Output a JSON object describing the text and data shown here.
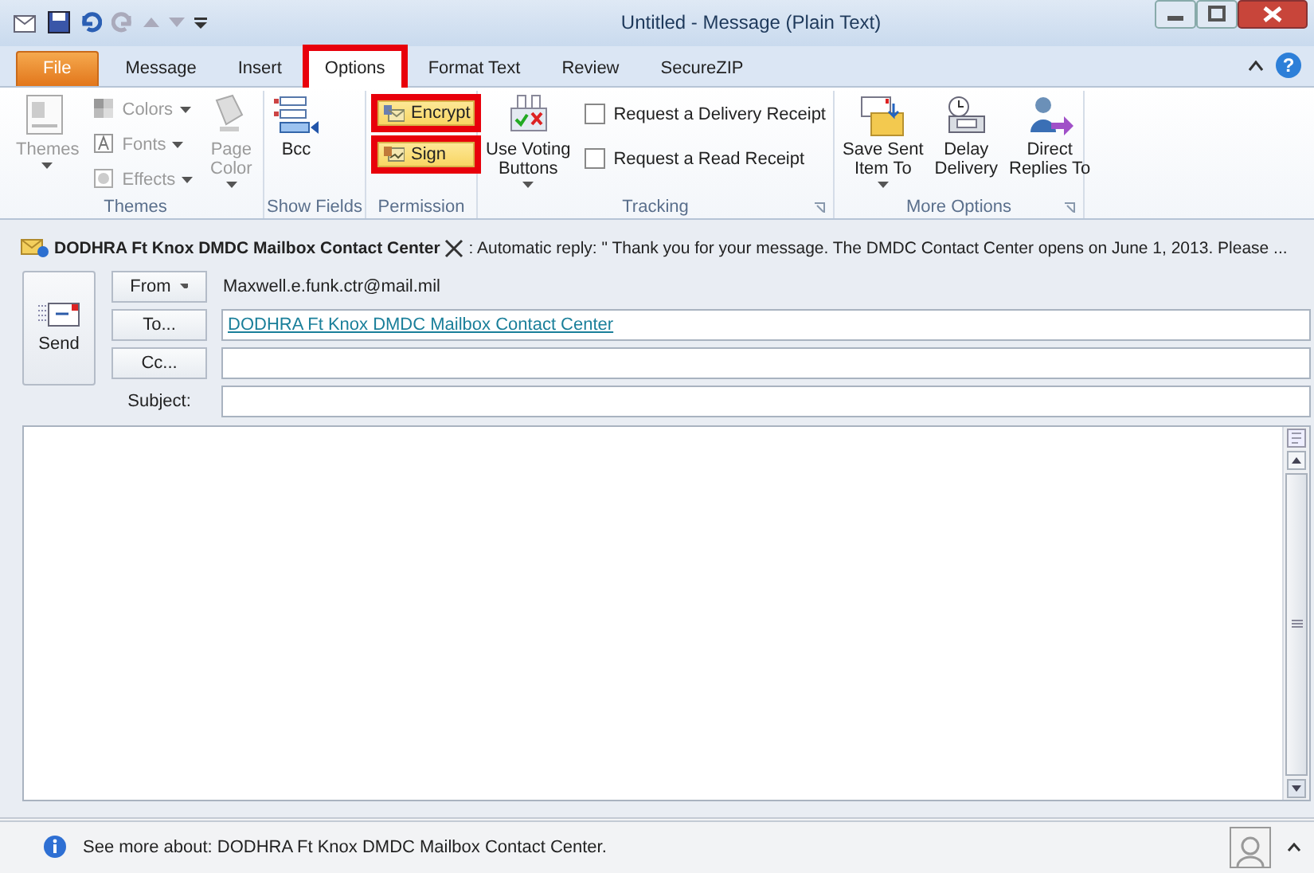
{
  "window": {
    "title": "Untitled - Message (Plain Text)"
  },
  "tabs": [
    {
      "label": "File",
      "kind": "file",
      "selected": false,
      "highlighted": false
    },
    {
      "label": "Message",
      "kind": "tab",
      "selected": false,
      "highlighted": false
    },
    {
      "label": "Insert",
      "kind": "tab",
      "selected": false,
      "highlighted": false
    },
    {
      "label": "Options",
      "kind": "tab",
      "selected": true,
      "highlighted": true
    },
    {
      "label": "Format Text",
      "kind": "tab",
      "selected": false,
      "highlighted": false
    },
    {
      "label": "Review",
      "kind": "tab",
      "selected": false,
      "highlighted": false
    },
    {
      "label": "SecureZIP",
      "kind": "tab",
      "selected": false,
      "highlighted": false
    }
  ],
  "help_label": "?",
  "ribbon_groups": [
    {
      "label": "Themes",
      "items": [
        {
          "kind": "large",
          "label": "Themes",
          "disabled": true,
          "dropdown": true,
          "on": false,
          "highlighted": false
        },
        {
          "kind": "small",
          "label": "Colors",
          "disabled": true,
          "dropdown": true,
          "on": false,
          "highlighted": false
        },
        {
          "kind": "small",
          "label": "Fonts",
          "disabled": true,
          "dropdown": true,
          "on": false,
          "highlighted": false
        },
        {
          "kind": "small",
          "label": "Effects",
          "disabled": true,
          "dropdown": true,
          "on": false,
          "highlighted": false
        },
        {
          "kind": "large",
          "label": "Page\nColor",
          "disabled": true,
          "dropdown": true,
          "on": false,
          "highlighted": false
        }
      ]
    },
    {
      "label": "Show Fields",
      "items": [
        {
          "kind": "large",
          "label": "Bcc",
          "disabled": false,
          "dropdown": false,
          "on": false,
          "highlighted": false
        }
      ]
    },
    {
      "label": "Permission",
      "items": [
        {
          "kind": "small",
          "label": "Encrypt",
          "disabled": false,
          "dropdown": false,
          "on": true,
          "highlighted": true
        },
        {
          "kind": "small",
          "label": "Sign",
          "disabled": false,
          "dropdown": false,
          "on": true,
          "highlighted": true
        }
      ]
    },
    {
      "label": "Tracking",
      "launcher": true,
      "items": [
        {
          "kind": "large",
          "label": "Use Voting\nButtons",
          "disabled": false,
          "dropdown": true,
          "on": false,
          "highlighted": false
        },
        {
          "kind": "checkbox",
          "label": "Request a Delivery Receipt",
          "checked": false
        },
        {
          "kind": "checkbox",
          "label": "Request a Read Receipt",
          "checked": false
        }
      ]
    },
    {
      "label": "More Options",
      "launcher": true,
      "items": [
        {
          "kind": "large",
          "label": "Save Sent\nItem To",
          "disabled": false,
          "dropdown": true,
          "on": false,
          "highlighted": false
        },
        {
          "kind": "large",
          "label": "Delay\nDelivery",
          "disabled": false,
          "dropdown": false,
          "on": false,
          "highlighted": false
        },
        {
          "kind": "large",
          "label": "Direct\nReplies To",
          "disabled": false,
          "dropdown": false,
          "on": false,
          "highlighted": false
        }
      ]
    }
  ],
  "infobar": {
    "sender": "DODHRA Ft Knox DMDC Mailbox Contact Center",
    "message": ": Automatic reply: \"  Thank you for your message. The DMDC Contact Center opens on June 1, 2013. Please ..."
  },
  "send_button": "Send",
  "fields": [
    {
      "kind": "button",
      "label": "From",
      "dropdown": true,
      "value": "Maxwell.e.funk.ctr@mail.mil",
      "boxed": false
    },
    {
      "kind": "button",
      "label": "To...",
      "dropdown": false,
      "value": "DODHRA Ft Knox DMDC Mailbox Contact Center",
      "boxed": true,
      "link": true
    },
    {
      "kind": "button",
      "label": "Cc...",
      "dropdown": false,
      "boxed": true
    },
    {
      "kind": "label",
      "label": "Subject:",
      "boxed": true
    }
  ],
  "people_pane": {
    "text": "See more about: DODHRA Ft Knox DMDC Mailbox Contact Center.",
    "expanded": false
  }
}
